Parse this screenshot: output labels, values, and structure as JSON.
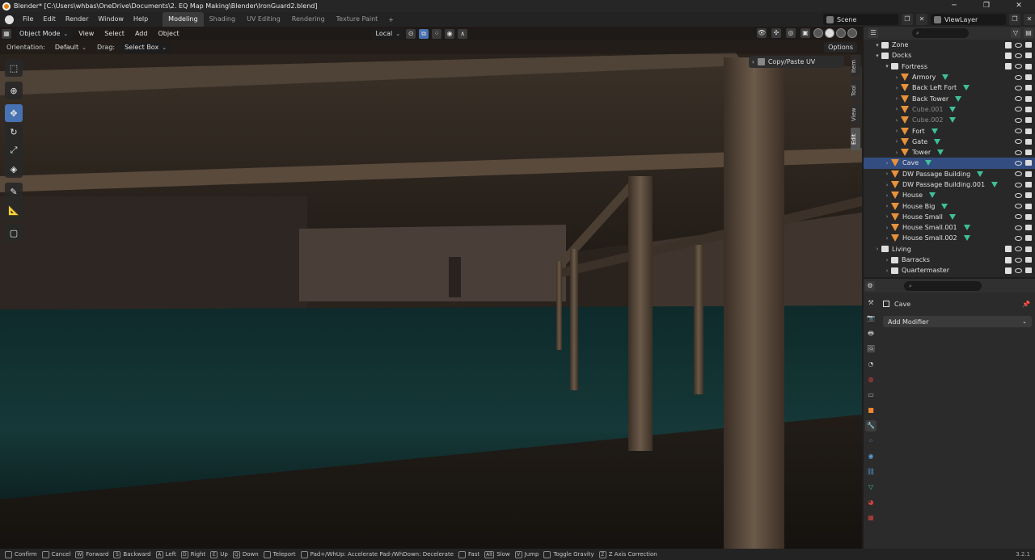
{
  "window": {
    "title": "Blender* [C:\\Users\\whbas\\OneDrive\\Documents\\2. EQ Map Making\\Blender\\IronGuard2.blend]"
  },
  "menu": [
    "File",
    "Edit",
    "Render",
    "Window",
    "Help"
  ],
  "workspaces": [
    "Modeling",
    "Shading",
    "UV Editing",
    "Rendering",
    "Texture Paint"
  ],
  "scene": {
    "name": "Scene",
    "view_layer": "ViewLayer"
  },
  "viewport": {
    "mode": "Object Mode",
    "menus": [
      "View",
      "Select",
      "Add",
      "Object"
    ],
    "transform_space": "Local",
    "orientation_label": "Orientation:",
    "orientation_value": "Default",
    "drag_label": "Drag:",
    "drag_value": "Select Box",
    "options": "Options",
    "npanel_tabs": [
      "Item",
      "Tool",
      "View",
      "Edit"
    ],
    "copy_paste_uv": "Copy/Paste UV"
  },
  "outliner": {
    "rows": [
      {
        "label": "Zone",
        "depth": 2,
        "kind": "collection",
        "dim": false
      },
      {
        "label": "Docks",
        "depth": 2,
        "kind": "collection",
        "dim": false
      },
      {
        "label": "Fortress",
        "depth": 3,
        "kind": "collection",
        "dim": false
      },
      {
        "label": "Armory",
        "depth": 4,
        "kind": "mesh",
        "dim": false
      },
      {
        "label": "Back Left Fort",
        "depth": 4,
        "kind": "mesh",
        "dim": false
      },
      {
        "label": "Back Tower",
        "depth": 4,
        "kind": "mesh",
        "dim": false
      },
      {
        "label": "Cube.001",
        "depth": 4,
        "kind": "mesh",
        "dim": true
      },
      {
        "label": "Cube.002",
        "depth": 4,
        "kind": "mesh",
        "dim": true
      },
      {
        "label": "Fort",
        "depth": 4,
        "kind": "mesh",
        "dim": false
      },
      {
        "label": "Gate",
        "depth": 4,
        "kind": "mesh",
        "dim": false
      },
      {
        "label": "Tower",
        "depth": 4,
        "kind": "mesh",
        "dim": false
      },
      {
        "label": "Cave",
        "depth": 3,
        "kind": "mesh",
        "dim": false,
        "selected": true
      },
      {
        "label": "DW Passage Building",
        "depth": 3,
        "kind": "mesh",
        "dim": false
      },
      {
        "label": "DW Passage Building.001",
        "depth": 3,
        "kind": "mesh",
        "dim": false
      },
      {
        "label": "House",
        "depth": 3,
        "kind": "mesh",
        "dim": false
      },
      {
        "label": "House Big",
        "depth": 3,
        "kind": "mesh",
        "dim": false
      },
      {
        "label": "House Small",
        "depth": 3,
        "kind": "mesh",
        "dim": false
      },
      {
        "label": "House Small.001",
        "depth": 3,
        "kind": "mesh",
        "dim": false
      },
      {
        "label": "House Small.002",
        "depth": 3,
        "kind": "mesh",
        "dim": false
      },
      {
        "label": "Living",
        "depth": 2,
        "kind": "collection",
        "dim": false
      },
      {
        "label": "Barracks",
        "depth": 3,
        "kind": "collection",
        "dim": false
      },
      {
        "label": "Quartermaster",
        "depth": 3,
        "kind": "collection",
        "dim": false
      }
    ]
  },
  "properties": {
    "object_name": "Cave",
    "add_modifier": "Add Modifier"
  },
  "status": {
    "items": [
      {
        "key": "",
        "label": "Confirm"
      },
      {
        "key": "",
        "label": "Cancel"
      },
      {
        "key": "W",
        "label": "Forward"
      },
      {
        "key": "S",
        "label": "Backward"
      },
      {
        "key": "A",
        "label": "Left"
      },
      {
        "key": "D",
        "label": "Right"
      },
      {
        "key": "E",
        "label": "Up"
      },
      {
        "key": "Q",
        "label": "Down"
      },
      {
        "key": "",
        "label": "Teleport"
      },
      {
        "key": "",
        "label": "Pad+/WhUp: Accelerate Pad-/WhDown: Decelerate"
      },
      {
        "key": "",
        "label": "Fast"
      },
      {
        "key": "Alt",
        "label": "Slow"
      },
      {
        "key": "V",
        "label": "Jump"
      },
      {
        "key": "",
        "label": "Toggle Gravity"
      },
      {
        "key": "Z",
        "label": "Z Axis Correction"
      }
    ],
    "version": "3.2.1"
  }
}
